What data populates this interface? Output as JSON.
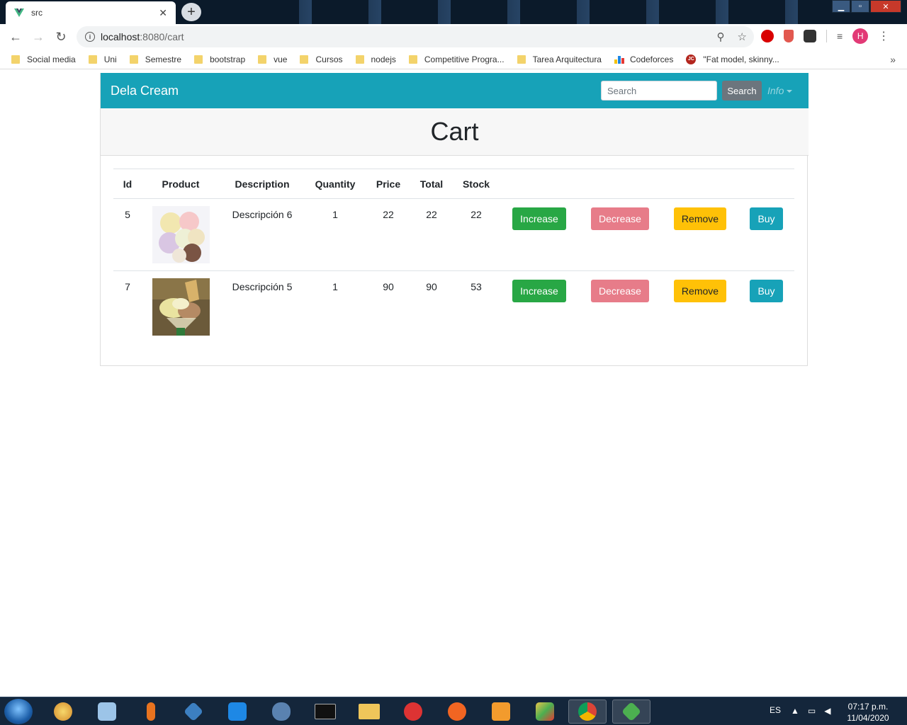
{
  "browser": {
    "tab_title": "src",
    "tab_close": "✕",
    "new_tab": "+",
    "url_host": "localhost",
    "url_path": ":8080/cart",
    "avatar_letter": "H",
    "bookmarks": [
      {
        "label": "Social media",
        "icon": "folder-icon"
      },
      {
        "label": "Uni",
        "icon": "folder-icon"
      },
      {
        "label": "Semestre",
        "icon": "folder-icon"
      },
      {
        "label": "bootstrap",
        "icon": "folder-icon"
      },
      {
        "label": "vue",
        "icon": "folder-icon"
      },
      {
        "label": "Cursos",
        "icon": "folder-icon"
      },
      {
        "label": "nodejs",
        "icon": "folder-icon"
      },
      {
        "label": "Competitive Progra...",
        "icon": "folder-icon"
      },
      {
        "label": "Tarea Arquitectura",
        "icon": "folder-icon"
      },
      {
        "label": "Codeforces",
        "icon": "codeforces-icon"
      },
      {
        "label": "\"Fat model, skinny...",
        "icon": "jc-icon"
      }
    ],
    "bookmarks_more": "»"
  },
  "navbar": {
    "brand": "Dela Cream",
    "search_placeholder": "Search",
    "search_button": "Search",
    "info_dropdown": "Info"
  },
  "page": {
    "title": "Cart"
  },
  "table": {
    "headers": [
      "Id",
      "Product",
      "Description",
      "Quantity",
      "Price",
      "Total",
      "Stock"
    ],
    "rows": [
      {
        "id": "5",
        "description": "Descripción 6",
        "quantity": "1",
        "price": "22",
        "total": "22",
        "stock": "22",
        "image": "ice-cream-scoops-image"
      },
      {
        "id": "7",
        "description": "Descripción 5",
        "quantity": "1",
        "price": "90",
        "total": "90",
        "stock": "53",
        "image": "ice-cream-sundae-image"
      }
    ],
    "buttons": {
      "increase": "Increase",
      "decrease": "Decrease",
      "remove": "Remove",
      "buy": "Buy"
    }
  },
  "taskbar": {
    "language": "ES",
    "time": "07:17 p.m.",
    "date": "11/04/2020",
    "apps": [
      "paint-icon",
      "virtualbox-icon",
      "microphone-icon",
      "visual-studio-icon",
      "vscode-icon",
      "postgresql-icon",
      "terminal-icon",
      "file-explorer-icon",
      "ccleaner-icon",
      "pen-tool-icon",
      "sublime-text-icon",
      "cube-app-icon",
      "chrome-icon",
      "git-icon"
    ]
  },
  "colors": {
    "navbar": "#17a2b8",
    "success": "#28a745",
    "danger": "#e77c89",
    "warning": "#ffc107",
    "info": "#17a2b8"
  }
}
